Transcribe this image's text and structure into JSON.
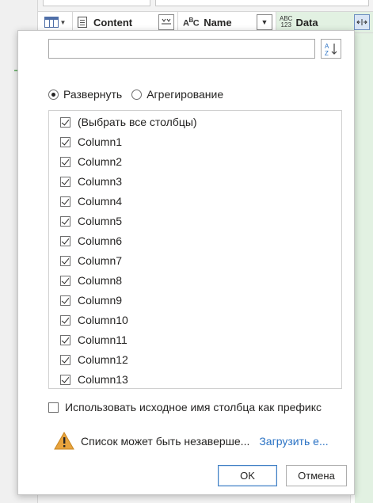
{
  "grid": {
    "columns": [
      {
        "label": "Content",
        "type_icon": "document-icon"
      },
      {
        "label": "Name",
        "type_icon": "text-type-icon",
        "type_text": "A B C"
      },
      {
        "label": "Data",
        "type_icon": "any-type-icon",
        "type_text": "ABC 123"
      }
    ]
  },
  "dialog": {
    "search": {
      "value": "",
      "placeholder": ""
    },
    "sort_button_icon": "sort-az-icon",
    "mode": {
      "expand_label": "Развернуть",
      "aggregate_label": "Агрегирование",
      "selected": "expand"
    },
    "columns_list": [
      {
        "label": "(Выбрать все столбцы)",
        "checked": true
      },
      {
        "label": "Column1",
        "checked": true
      },
      {
        "label": "Column2",
        "checked": true
      },
      {
        "label": "Column3",
        "checked": true
      },
      {
        "label": "Column4",
        "checked": true
      },
      {
        "label": "Column5",
        "checked": true
      },
      {
        "label": "Column6",
        "checked": true
      },
      {
        "label": "Column7",
        "checked": true
      },
      {
        "label": "Column8",
        "checked": true
      },
      {
        "label": "Column9",
        "checked": true
      },
      {
        "label": "Column10",
        "checked": true
      },
      {
        "label": "Column11",
        "checked": true
      },
      {
        "label": "Column12",
        "checked": true
      },
      {
        "label": "Column13",
        "checked": true
      }
    ],
    "prefix_label": "Использовать исходное имя столбца как префикс",
    "prefix_checked": false,
    "warning_text": "Список может быть незаверше...",
    "load_more_link": "Загрузить е...",
    "ok_label": "OK",
    "cancel_label": "Отмена",
    "colors": {
      "accent": "#3f7fc4",
      "link": "#2a72c4",
      "warning": "#e8a33d",
      "data_column": "#e2f1e2"
    }
  }
}
